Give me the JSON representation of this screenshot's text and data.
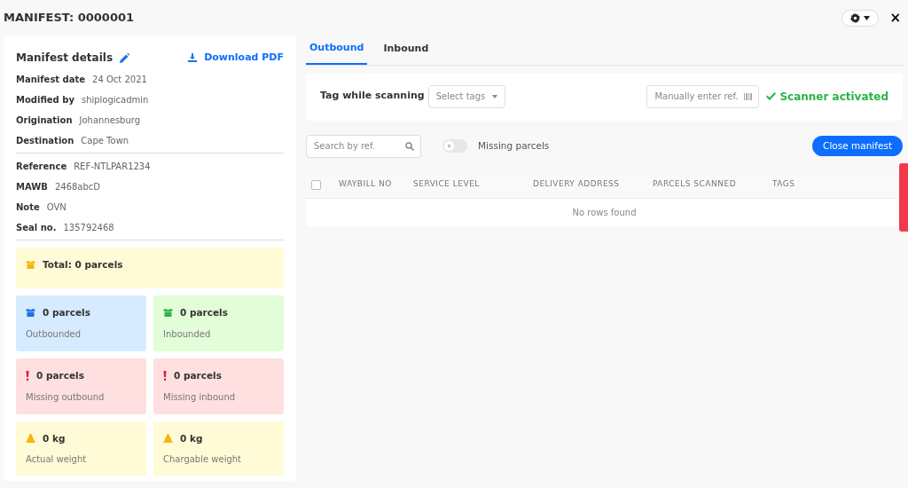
{
  "window": {
    "title": "MANIFEST: 0000001",
    "close": "×"
  },
  "details": {
    "heading": "Manifest details",
    "download": "Download PDF",
    "groups": [
      [
        {
          "label": "Manifest date",
          "value": "24 Oct 2021"
        },
        {
          "label": "Modified by",
          "value": "shiplogicadmin"
        },
        {
          "label": "Origination",
          "value": "Johannesburg"
        },
        {
          "label": "Destination",
          "value": "Cape Town"
        }
      ],
      [
        {
          "label": "Reference",
          "value": "REF-NTLPAR1234"
        },
        {
          "label": "MAWB",
          "value": "2468abcD"
        },
        {
          "label": "Note",
          "value": "OVN"
        },
        {
          "label": "Seal no.",
          "value": "135792468"
        }
      ]
    ]
  },
  "stats": [
    {
      "kind": "total",
      "value": "Total: 0 parcels"
    },
    {
      "kind": "outbound",
      "value": "0 parcels",
      "caption": "Outbounded"
    },
    {
      "kind": "inbound",
      "value": "0 parcels",
      "caption": "Inbounded"
    },
    {
      "kind": "missing",
      "value": "0 parcels",
      "caption": "Missing outbound"
    },
    {
      "kind": "missing",
      "value": "0 parcels",
      "caption": "Missing inbound"
    },
    {
      "kind": "weight",
      "value": "0 kg",
      "caption": "Actual weight"
    },
    {
      "kind": "weight",
      "value": "0 kg",
      "caption": "Chargable weight"
    }
  ],
  "tabs": [
    {
      "label": "Outbound",
      "selected": true
    },
    {
      "label": "Inbound",
      "selected": false
    }
  ],
  "scan_bar": {
    "label": "Tag while scanning",
    "tags_placeholder": "Select tags",
    "ref_placeholder": "Manually enter ref.",
    "status": "Scanner activated"
  },
  "filters": {
    "search_placeholder": "Search by ref.",
    "missing_toggle": {
      "label": "Missing parcels",
      "on": false
    },
    "close_button": "Close manifest"
  },
  "table": {
    "select_all": {
      "checked": false
    },
    "columns": [
      "WAYBILL NO",
      "SERVICE LEVEL",
      "DELIVERY ADDRESS",
      "PARCELS SCANNED",
      "TAGS"
    ],
    "empty": "No rows found"
  }
}
